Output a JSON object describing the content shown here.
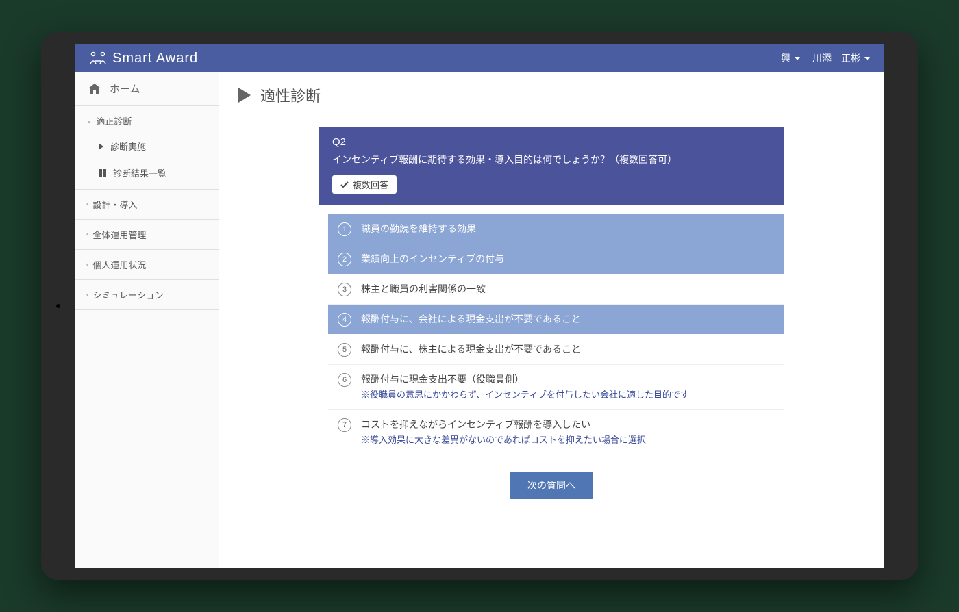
{
  "header": {
    "app_name": "Smart Award",
    "org_indicator": "興",
    "user_name": "川添　正彬"
  },
  "sidebar": {
    "home": "ホーム",
    "sections": [
      {
        "label": "適正診断",
        "expanded": true,
        "children": [
          {
            "label": "診断実施",
            "icon": "play"
          },
          {
            "label": "診断結果一覧",
            "icon": "grid"
          }
        ]
      },
      {
        "label": "設計・導入"
      },
      {
        "label": "全体運用管理"
      },
      {
        "label": "個人運用状況"
      },
      {
        "label": "シミュレーション"
      }
    ]
  },
  "page": {
    "title": "適性診断",
    "question": {
      "number": "Q2",
      "text": "インセンティブ報酬に期待する効果・導入目的は何でしょうか？（複数回答可）",
      "badge": "複数回答",
      "options": [
        {
          "num": "1",
          "text": "職員の勤続を維持する効果",
          "selected": true
        },
        {
          "num": "2",
          "text": "業績向上のインセンティブの付与",
          "selected": true
        },
        {
          "num": "3",
          "text": "株主と職員の利害関係の一致",
          "selected": false
        },
        {
          "num": "4",
          "text": "報酬付与に、会社による現金支出が不要であること",
          "selected": true
        },
        {
          "num": "5",
          "text": "報酬付与に、株主による現金支出が不要であること",
          "selected": false
        },
        {
          "num": "6",
          "text": "報酬付与に現金支出不要（役職員側）",
          "note": "※役職員の意思にかかわらず、インセンティブを付与したい会社に適した目的です",
          "selected": false
        },
        {
          "num": "7",
          "text": "コストを抑えながらインセンティブ報酬を導入したい",
          "note": "※導入効果に大きな差異がないのであればコストを抑えたい場合に選択",
          "selected": false
        }
      ],
      "next_button": "次の質問へ"
    }
  }
}
